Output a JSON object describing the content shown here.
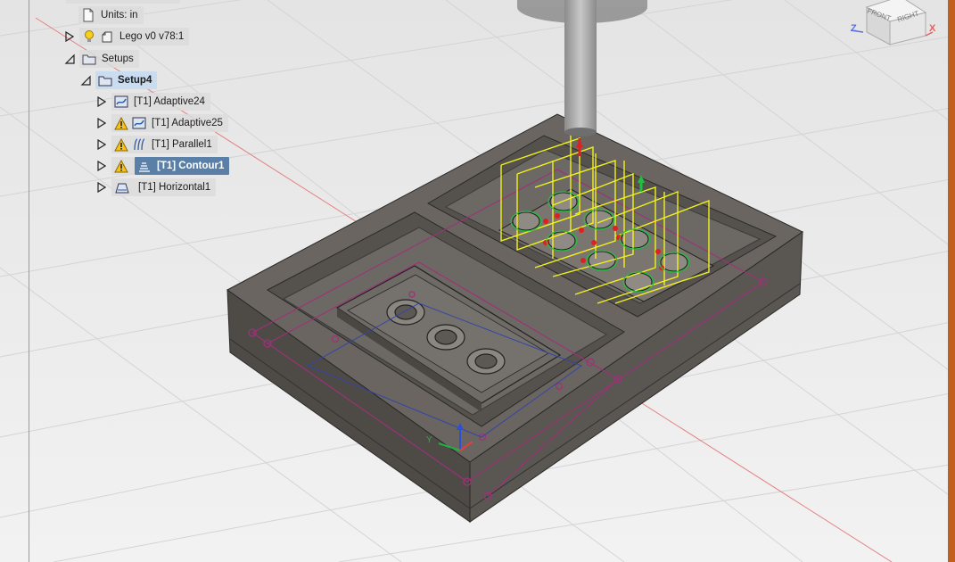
{
  "browser_tree": {
    "units": {
      "label": "Units: in"
    },
    "component": {
      "label": "Lego v0 v78:1"
    },
    "setups": {
      "label": "Setups"
    },
    "setup": {
      "label": "Setup4"
    },
    "operations": [
      {
        "label": "[T1] Adaptive24",
        "warning": false,
        "selected": false,
        "icon": "adaptive-clearing-icon"
      },
      {
        "label": "[T1] Adaptive25",
        "warning": true,
        "selected": false,
        "icon": "adaptive-clearing-icon"
      },
      {
        "label": "[T1] Parallel1",
        "warning": true,
        "selected": false,
        "icon": "parallel-icon"
      },
      {
        "label": "[T1] Contour1",
        "warning": true,
        "selected": true,
        "icon": "contour-icon"
      },
      {
        "label": "[T1] Horizontal1",
        "warning": false,
        "selected": false,
        "icon": "horizontal-icon"
      }
    ]
  },
  "viewcube": {
    "front": "FRONT",
    "right": "RIGHT",
    "axis_z": "Z",
    "axis_x": "X"
  },
  "triad": {
    "axis_y": "Y"
  },
  "colors": {
    "background": "#ececec",
    "stock": "#5e5a55",
    "toolpath": "#f2f21c",
    "selection": "#5b80a8",
    "sketch": "#a0307a",
    "axis_red": "#e06060"
  }
}
